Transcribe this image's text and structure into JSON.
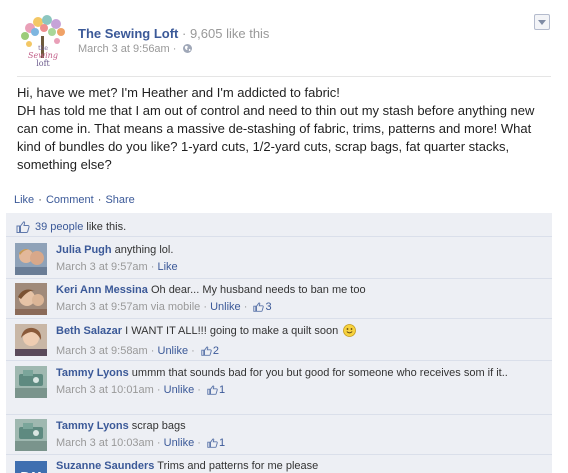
{
  "post": {
    "page_name": "The Sewing Loft",
    "likes_suffix": " · 9,605 like this",
    "timestamp": "March 3 at 9:56am",
    "meta_sep": " · ",
    "logo_text": [
      "the",
      "Sewing",
      "loft"
    ],
    "message": [
      "Hi, have we met? I'm Heather and I'm addicted to fabric!",
      "DH has told me that I am out of control and need to thin out my stash before anything new can come in. That means a massive de-stashing of fabric, trims, patterns and more! What kind of bundles do you like? 1-yard cuts, 1/2-yard cuts, scrap bags, fat quarter stacks, something else?"
    ],
    "actions": {
      "like": "Like",
      "comment": "Comment",
      "share": "Share",
      "sep": " · "
    }
  },
  "likes": {
    "people": "39 people",
    "suffix": " like this."
  },
  "comments": [
    {
      "author": "Julia Pugh",
      "text": " anything lol.",
      "time": "March 3 at 9:57am",
      "via": "",
      "action": "Like",
      "likes": ""
    },
    {
      "author": "Keri Ann Messina",
      "text": " Oh dear... My husband needs to ban me too",
      "time": "March 3 at 9:57am",
      "via": " via mobile",
      "action": "Unlike",
      "likes": "3"
    },
    {
      "author": "Beth Salazar",
      "text": " I WANT IT ALL!!! going to make a quilt soon ",
      "time": "March 3 at 9:58am",
      "via": "",
      "action": "Unlike",
      "likes": "2"
    },
    {
      "author": "Tammy Lyons",
      "text": " ummm that sounds bad for you but good for someone who receives som if it..",
      "time": "March 3 at 10:01am",
      "via": "",
      "action": "Unlike",
      "likes": "1"
    },
    {
      "author": "Tammy Lyons",
      "text": " scrap bags",
      "time": "March 3 at 10:03am",
      "via": "",
      "action": "Unlike",
      "likes": "1"
    },
    {
      "author": "Suzanne Saunders",
      "text": " Trims and patterns for me please",
      "time": "",
      "via": "",
      "action": "",
      "likes": ""
    }
  ],
  "colors": {
    "link": "#3b5998",
    "ufi_bg": "#edeff4",
    "meta": "#999999"
  },
  "icons": [
    "globe-icon",
    "chevron-down-icon",
    "thumbs-up-icon",
    "smiley-icon"
  ]
}
